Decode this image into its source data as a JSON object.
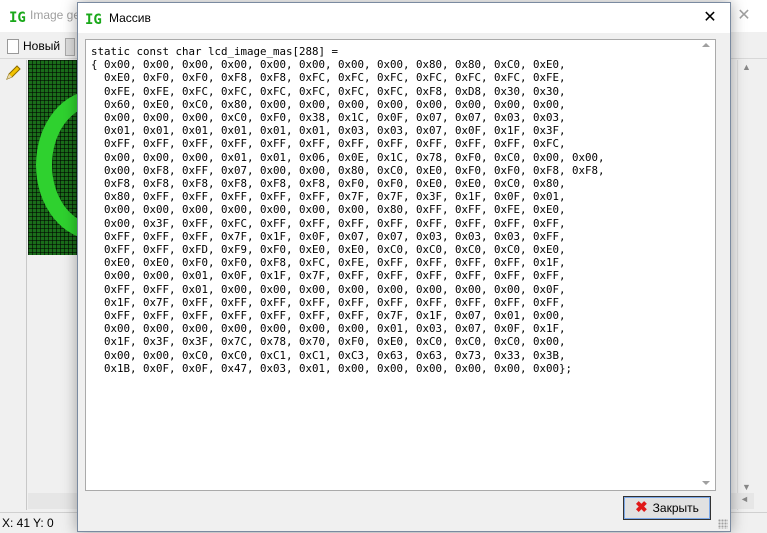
{
  "app": {
    "title": "Image ge",
    "toolbar": {
      "new_label": "Новый"
    },
    "status": {
      "x": "X: 41",
      "y": "Y: 0"
    }
  },
  "dialog": {
    "title": "Массив",
    "close_button_label": "Закрыть",
    "code_lines": [
      "static const char lcd_image_mas[288] =",
      "{ 0x00, 0x00, 0x00, 0x00, 0x00, 0x00, 0x00, 0x00, 0x80, 0x80, 0xC0, 0xE0,",
      "  0xE0, 0xF0, 0xF0, 0xF8, 0xF8, 0xFC, 0xFC, 0xFC, 0xFC, 0xFC, 0xFC, 0xFE,",
      "  0xFE, 0xFE, 0xFC, 0xFC, 0xFC, 0xFC, 0xFC, 0xFC, 0xF8, 0xD8, 0x30, 0x30,",
      "  0x60, 0xE0, 0xC0, 0x80, 0x00, 0x00, 0x00, 0x00, 0x00, 0x00, 0x00, 0x00,",
      "  0x00, 0x00, 0x00, 0xC0, 0xF0, 0x38, 0x1C, 0x0F, 0x07, 0x07, 0x03, 0x03,",
      "  0x01, 0x01, 0x01, 0x01, 0x01, 0x01, 0x03, 0x03, 0x07, 0x0F, 0x1F, 0x3F,",
      "  0xFF, 0xFF, 0xFF, 0xFF, 0xFF, 0xFF, 0xFF, 0xFF, 0xFF, 0xFF, 0xFF, 0xFC,",
      "  0x00, 0x00, 0x00, 0x01, 0x01, 0x06, 0x0E, 0x1C, 0x78, 0xF0, 0xC0, 0x00, 0x00,",
      "  0x00, 0xF8, 0xFF, 0x07, 0x00, 0x00, 0x80, 0xC0, 0xE0, 0xF0, 0xF0, 0xF8, 0xF8,",
      "  0xF8, 0xF8, 0xF8, 0xF8, 0xF8, 0xF8, 0xF0, 0xF0, 0xE0, 0xE0, 0xC0, 0x80,",
      "  0x80, 0xFF, 0xFF, 0xFF, 0xFF, 0xFF, 0x7F, 0x7F, 0x3F, 0x1F, 0x0F, 0x01,",
      "  0x00, 0x00, 0x00, 0x00, 0x00, 0x00, 0x00, 0x80, 0xFF, 0xFF, 0xFE, 0xE0,",
      "  0x00, 0x3F, 0xFF, 0xFC, 0xFF, 0xFF, 0xFF, 0xFF, 0xFF, 0xFF, 0xFF, 0xFF,",
      "  0xFF, 0xFF, 0xFF, 0x7F, 0x1F, 0x0F, 0x07, 0x07, 0x03, 0x03, 0x03, 0xFF,",
      "  0xFF, 0xFF, 0xFD, 0xF9, 0xF0, 0xE0, 0xE0, 0xC0, 0xC0, 0xC0, 0xC0, 0xE0,",
      "  0xE0, 0xE0, 0xF0, 0xF0, 0xF8, 0xFC, 0xFE, 0xFF, 0xFF, 0xFF, 0xFF, 0x1F,",
      "  0x00, 0x00, 0x01, 0x0F, 0x1F, 0x7F, 0xFF, 0xFF, 0xFF, 0xFF, 0xFF, 0xFF,",
      "  0xFF, 0xFF, 0x01, 0x00, 0x00, 0x00, 0x00, 0x00, 0x00, 0x00, 0x00, 0x0F,",
      "  0x1F, 0x7F, 0xFF, 0xFF, 0xFF, 0xFF, 0xFF, 0xFF, 0xFF, 0xFF, 0xFF, 0xFF,",
      "  0xFF, 0xFF, 0xFF, 0xFF, 0xFF, 0xFF, 0xFF, 0x7F, 0x1F, 0x07, 0x01, 0x00,",
      "  0x00, 0x00, 0x00, 0x00, 0x00, 0x00, 0x00, 0x01, 0x03, 0x07, 0x0F, 0x1F,",
      "  0x1F, 0x3F, 0x3F, 0x7C, 0x78, 0x70, 0xF0, 0xE0, 0xC0, 0xC0, 0xC0, 0x00,",
      "  0x00, 0x00, 0xC0, 0xC0, 0xC1, 0xC1, 0xC3, 0x63, 0x63, 0x73, 0x33, 0x3B,",
      "  0x1B, 0x0F, 0x0F, 0x47, 0x03, 0x01, 0x00, 0x00, 0x00, 0x00, 0x00, 0x00};"
    ]
  },
  "colors": {
    "lcd_background": "#1a6d1a",
    "lcd_pixel_on": "#2fd12f",
    "logo_green": "#1aa81a",
    "close_x": "#e01818"
  }
}
